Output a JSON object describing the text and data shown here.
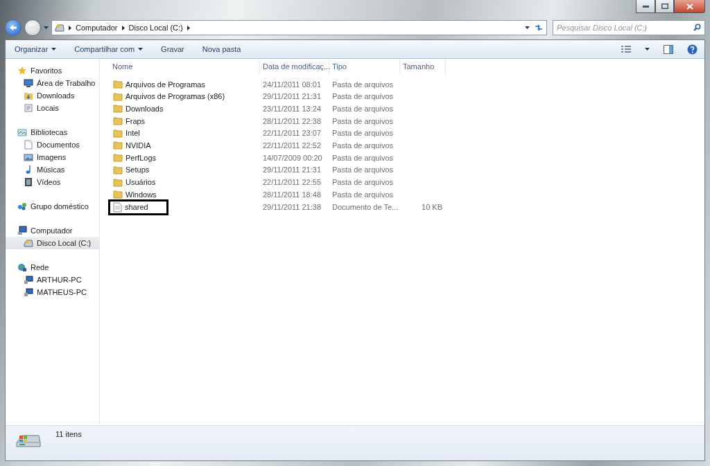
{
  "address_bar": {
    "breadcrumbs": [
      "Computador",
      "Disco Local (C:)"
    ]
  },
  "search": {
    "placeholder": "Pesquisar Disco Local (C:)"
  },
  "toolbar": {
    "buttons": [
      {
        "label": "Organizar",
        "dropdown": true
      },
      {
        "label": "Compartilhar com",
        "dropdown": true
      },
      {
        "label": "Gravar",
        "dropdown": false
      },
      {
        "label": "Nova pasta",
        "dropdown": false
      }
    ]
  },
  "sidebar": {
    "groups": [
      {
        "label": "Favoritos",
        "kind": "star",
        "children": [
          {
            "label": "Área de Trabalho",
            "kind": "desktop",
            "selected": false
          },
          {
            "label": "Downloads",
            "kind": "downloads",
            "selected": false
          },
          {
            "label": "Locais",
            "kind": "places",
            "selected": false
          }
        ]
      },
      {
        "label": "Bibliotecas",
        "kind": "library",
        "children": [
          {
            "label": "Documentos",
            "kind": "document",
            "selected": false
          },
          {
            "label": "Imagens",
            "kind": "images",
            "selected": false
          },
          {
            "label": "Músicas",
            "kind": "music",
            "selected": false
          },
          {
            "label": "Vídeos",
            "kind": "video",
            "selected": false
          }
        ]
      },
      {
        "label": "Grupo doméstico",
        "kind": "homegroup"
      },
      {
        "label": "Computador",
        "kind": "computer",
        "children": [
          {
            "label": "Disco Local (C:)",
            "kind": "drive",
            "selected": true
          }
        ]
      },
      {
        "label": "Rede",
        "kind": "network",
        "children": [
          {
            "label": "ARTHUR-PC",
            "kind": "pc",
            "selected": false
          },
          {
            "label": "MATHEUS-PC",
            "kind": "pc",
            "selected": false
          }
        ]
      }
    ]
  },
  "table": {
    "columns": [
      "Nome",
      "Data de modificaç...",
      "Tipo",
      "Tamanho"
    ],
    "rows": [
      {
        "kind": "folder",
        "name": "Arquivos de Programas",
        "date": "24/11/2011 08:01",
        "type": "Pasta de arquivos",
        "highlighted": false
      },
      {
        "kind": "folder",
        "name": "Arquivos de Programas (x86)",
        "date": "29/11/2011 21:31",
        "type": "Pasta de arquivos",
        "highlighted": false
      },
      {
        "kind": "folder",
        "name": "Downloads",
        "date": "23/11/2011 13:24",
        "type": "Pasta de arquivos",
        "highlighted": false
      },
      {
        "kind": "folder",
        "name": "Fraps",
        "date": "28/11/2011 22:38",
        "type": "Pasta de arquivos",
        "highlighted": false
      },
      {
        "kind": "folder",
        "name": "Intel",
        "date": "22/11/2011 23:07",
        "type": "Pasta de arquivos",
        "highlighted": false
      },
      {
        "kind": "folder",
        "name": "NVIDIA",
        "date": "22/11/2011 22:52",
        "type": "Pasta de arquivos",
        "highlighted": false
      },
      {
        "kind": "folder",
        "name": "PerfLogs",
        "date": "14/07/2009 00:20",
        "type": "Pasta de arquivos",
        "highlighted": false
      },
      {
        "kind": "folder",
        "name": "Setups",
        "date": "29/11/2011 21:31",
        "type": "Pasta de arquivos",
        "highlighted": false
      },
      {
        "kind": "folder",
        "name": "Usuários",
        "date": "22/11/2011 22:55",
        "type": "Pasta de arquivos",
        "highlighted": false
      },
      {
        "kind": "folder",
        "name": "Windows",
        "date": "28/11/2011 18:48",
        "type": "Pasta de arquivos",
        "highlighted": false
      },
      {
        "kind": "file",
        "name": "shared",
        "date": "29/11/2011 21:38",
        "type": "Documento de Te...",
        "size": "10 KB",
        "highlighted": true
      }
    ]
  },
  "status_bar": {
    "text": "11 itens"
  }
}
